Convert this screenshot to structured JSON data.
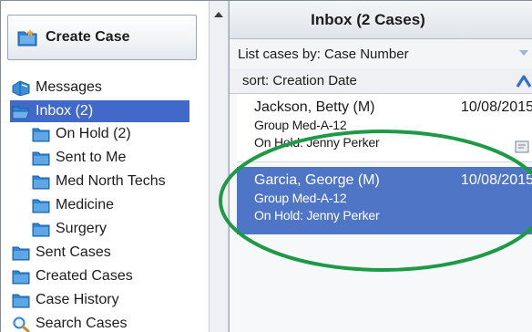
{
  "sidebar": {
    "create_case": "Create Case",
    "items": [
      {
        "label": "Messages",
        "icon": "mailbox-icon"
      },
      {
        "label": "Inbox (2)",
        "icon": "open-folder-icon",
        "selected": true
      },
      {
        "label": "On Hold (2)",
        "icon": "folder-icon"
      },
      {
        "label": "Sent to Me",
        "icon": "folder-icon"
      },
      {
        "label": "Med North Techs",
        "icon": "folder-icon"
      },
      {
        "label": "Medicine",
        "icon": "folder-icon"
      },
      {
        "label": "Surgery",
        "icon": "folder-icon"
      },
      {
        "label": "Sent Cases",
        "icon": "folder-icon"
      },
      {
        "label": "Created Cases",
        "icon": "folder-icon"
      },
      {
        "label": "Case History",
        "icon": "folder-icon"
      },
      {
        "label": "Search Cases",
        "icon": "search-icon"
      }
    ]
  },
  "inbox": {
    "title": "Inbox (2 Cases)",
    "list_by": "List cases by: Case Number",
    "sort": "sort: Creation Date",
    "cases": [
      {
        "name": "Jackson, Betty (M)",
        "date": "10/08/2015",
        "group": "Group Med-A-12",
        "status": "On Hold: Jenny Perker"
      },
      {
        "name": "Garcia, George (M)",
        "date": "10/08/2015",
        "group": "Group Med-A-12",
        "status": "On Hold: Jenny Perker"
      }
    ]
  },
  "colors": {
    "selection": "#4169c9",
    "selected_case": "#4f75c7",
    "highlight_ring": "#1e9a47",
    "folder": "#2f86d6"
  }
}
